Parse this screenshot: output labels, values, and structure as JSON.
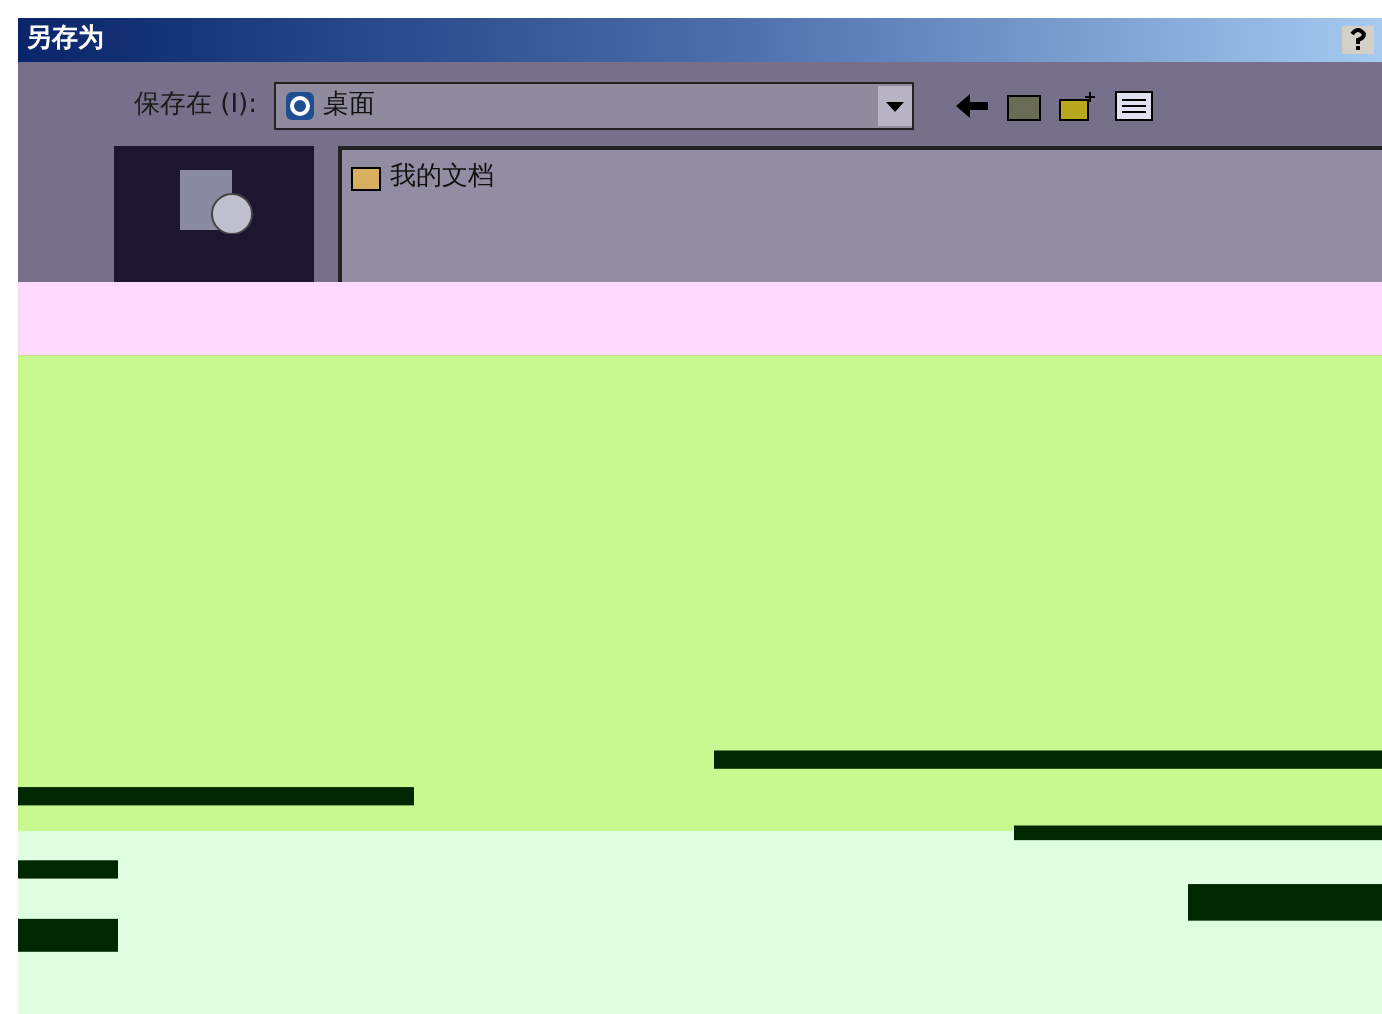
{
  "window": {
    "title": "另存为"
  },
  "save_in": {
    "label": "保存在 (I):",
    "value": "桌面"
  },
  "files": [
    {
      "name": "我的文档"
    }
  ]
}
